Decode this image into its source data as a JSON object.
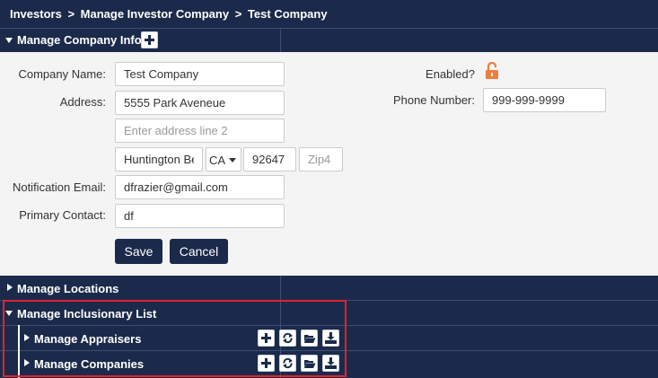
{
  "breadcrumb": [
    "Investors",
    "Manage Investor Company",
    "Test Company"
  ],
  "breadcrumb_separator": ">",
  "company_info": {
    "title": "Manage Company Info",
    "fields": {
      "company_name_label": "Company Name:",
      "company_name_value": "Test Company",
      "address_label": "Address:",
      "address_line1_value": "5555 Park Aveneue",
      "address_line2_placeholder": "Enter address line 2",
      "city_value": "Huntington Be",
      "state_value": "CA",
      "zip_value": "92647",
      "zip4_placeholder": "Zip4",
      "notification_email_label": "Notification Email:",
      "notification_email_value": "dfrazier@gmail.com",
      "primary_contact_label": "Primary Contact:",
      "primary_contact_value": "df",
      "enabled_label": "Enabled?",
      "phone_label": "Phone Number:",
      "phone_value": "999-999-9999"
    },
    "save_label": "Save",
    "cancel_label": "Cancel"
  },
  "sections": {
    "locations": "Manage Locations",
    "inclusionary": "Manage Inclusionary List",
    "appraisers": "Manage Appraisers",
    "companies": "Manage Companies"
  },
  "colors": {
    "navy": "#1b2a4a",
    "highlight": "#e0232e",
    "lock": "#f07b3f"
  },
  "icons": [
    "plus-icon",
    "refresh-icon",
    "folder-open-icon",
    "download-icon",
    "unlock-icon"
  ]
}
